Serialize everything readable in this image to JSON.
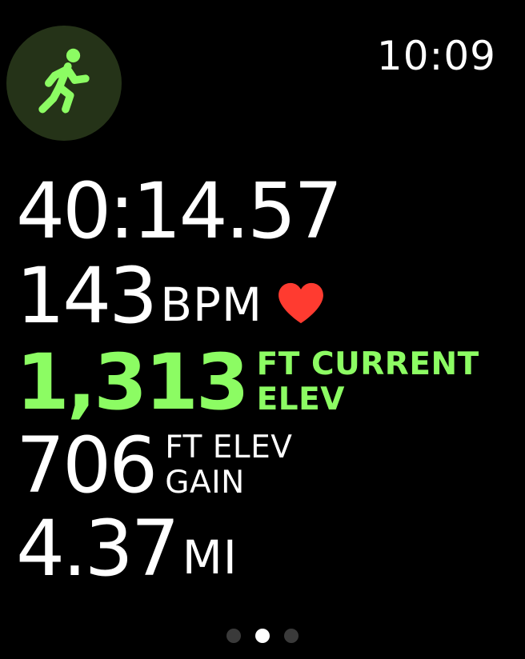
{
  "status": {
    "time": "10:09"
  },
  "workout": {
    "icon": "running-figure-icon",
    "accent_color": "#8CFC63"
  },
  "metrics": {
    "elapsed_time": "40:14.57",
    "heart_rate": {
      "value": "143",
      "unit": "BPM",
      "icon": "heart-icon",
      "color": "#FF3B30"
    },
    "current_elevation": {
      "value": "1,313",
      "unit_line1": "FT CURRENT",
      "unit_line2": "ELEV"
    },
    "elevation_gain": {
      "value": "706",
      "unit_line1": "FT ELEV",
      "unit_line2": "GAIN"
    },
    "distance": {
      "value": "4.37",
      "unit": "MI"
    }
  },
  "pagination": {
    "pages": 3,
    "current_index": 1
  }
}
